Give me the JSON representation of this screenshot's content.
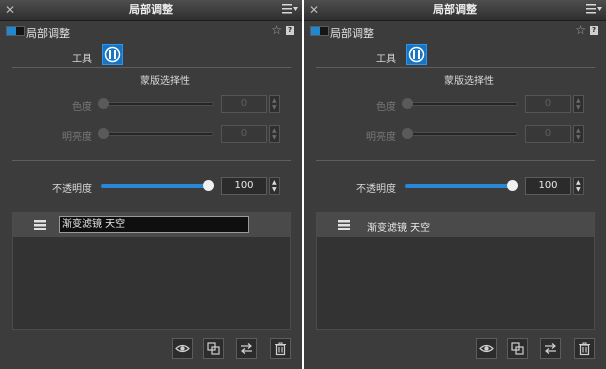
{
  "panels": [
    {
      "title": "局部调整",
      "section_label": "局部调整",
      "help": "?",
      "tool_label": "工具",
      "mask_title": "蒙版选择性",
      "hue": {
        "label": "色度",
        "value": "0",
        "level": 0
      },
      "brightness": {
        "label": "明亮度",
        "value": "0",
        "level": 0
      },
      "opacity": {
        "label": "不透明度",
        "value": "100",
        "level": 100
      },
      "layers": [
        {
          "name": "渐变滤镜 天空",
          "editing": true
        }
      ],
      "footer": [
        "eye-icon",
        "duplicate-icon",
        "swap-icon",
        "trash-icon"
      ]
    },
    {
      "title": "局部调整",
      "section_label": "局部调整",
      "help": "?",
      "tool_label": "工具",
      "mask_title": "蒙版选择性",
      "hue": {
        "label": "色度",
        "value": "0",
        "level": 0
      },
      "brightness": {
        "label": "明亮度",
        "value": "0",
        "level": 0
      },
      "opacity": {
        "label": "不透明度",
        "value": "100",
        "level": 100
      },
      "layers": [
        {
          "name": "渐变滤镜 天空",
          "editing": false
        }
      ],
      "footer": [
        "eye-icon",
        "duplicate-icon",
        "swap-icon",
        "trash-icon"
      ]
    }
  ],
  "colors": {
    "accent": "#1e88d0",
    "panel_bg": "#3c3c3c",
    "list_bg": "#333333"
  }
}
